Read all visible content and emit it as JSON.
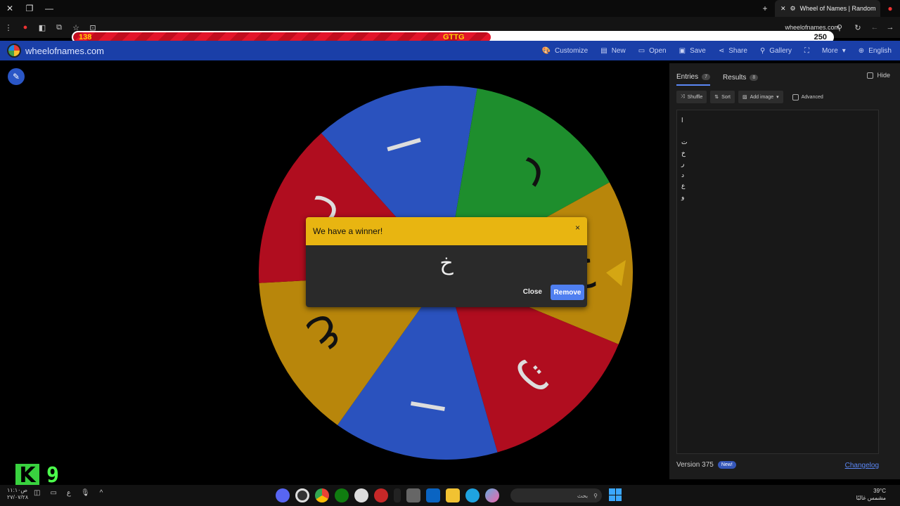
{
  "browser": {
    "tab_title": "Wheel of Names | Random",
    "url": "wheelofnames.com"
  },
  "hp_bar": {
    "left_value": "138",
    "center_label": "GTTG",
    "right_value": "250",
    "fill_fraction": 0.55
  },
  "app": {
    "site_name": "wheelofnames.com",
    "menu": [
      "Customize",
      "New",
      "Open",
      "Save",
      "Share",
      "Gallery",
      "More",
      "English"
    ]
  },
  "wheel": {
    "segments": [
      {
        "label": "ا",
        "color": "#2a52be"
      },
      {
        "label": "ر",
        "color": "#1e8e2d"
      },
      {
        "label": "ج",
        "color": "#b8860b"
      },
      {
        "label": "ت",
        "color": "#b00d1f"
      },
      {
        "label": "ا",
        "color": "#2a52be"
      },
      {
        "label": "ع",
        "color": "#b8860b"
      },
      {
        "label": "خ",
        "color": "#b00d1f"
      }
    ]
  },
  "dialog": {
    "title": "We have a winner!",
    "close_x": "×",
    "winner": "خ",
    "close_label": "Close",
    "remove_label": "Remove"
  },
  "panel": {
    "tabs": [
      {
        "label": "Entries",
        "count": "7"
      },
      {
        "label": "Results",
        "count": "8"
      }
    ],
    "hide_label": "Hide",
    "tools": [
      "Shuffle",
      "Sort",
      "Add image"
    ],
    "advanced_label": "Advanced",
    "entries": [
      "ا",
      "",
      "ت",
      "خ",
      "ر",
      "د",
      "ع",
      "و"
    ],
    "version": "Version 375",
    "new_badge": "New!",
    "changelog": "Changelog"
  },
  "taskbar": {
    "search_text": "بحث",
    "weather": "39°C",
    "weather_desc": "مشمس غالبًا",
    "left_time": "ص١١:١٠",
    "left_date": "٢٧/٠٧/٢٨"
  },
  "overlay": {
    "k": "K",
    "n": "9"
  }
}
